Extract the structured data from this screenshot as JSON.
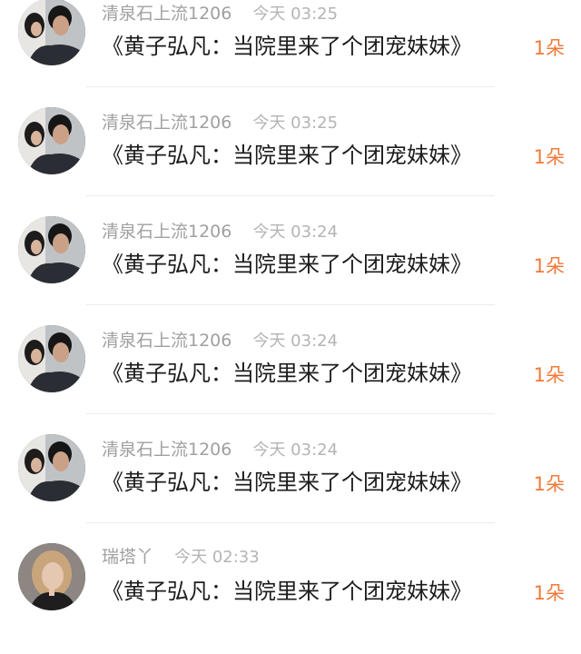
{
  "comments": [
    {
      "user": "清泉石上流1206",
      "time": "今天 03:25",
      "text": "《黄子弘凡：当院里来了个团宠妹妹》",
      "gift": "1朵",
      "avatar_icon": "couple-photo-avatar"
    },
    {
      "user": "清泉石上流1206",
      "time": "今天 03:25",
      "text": "《黄子弘凡：当院里来了个团宠妹妹》",
      "gift": "1朵",
      "avatar_icon": "couple-photo-avatar"
    },
    {
      "user": "清泉石上流1206",
      "time": "今天 03:24",
      "text": "《黄子弘凡：当院里来了个团宠妹妹》",
      "gift": "1朵",
      "avatar_icon": "couple-photo-avatar"
    },
    {
      "user": "清泉石上流1206",
      "time": "今天 03:24",
      "text": "《黄子弘凡：当院里来了个团宠妹妹》",
      "gift": "1朵",
      "avatar_icon": "couple-photo-avatar"
    },
    {
      "user": "清泉石上流1206",
      "time": "今天 03:24",
      "text": "《黄子弘凡：当院里来了个团宠妹妹》",
      "gift": "1朵",
      "avatar_icon": "couple-photo-avatar"
    },
    {
      "user": "瑞塔丫",
      "time": "今天 02:33",
      "text": "《黄子弘凡：当院里来了个团宠妹妹》",
      "gift": "1朵",
      "avatar_icon": "blonde-woman-avatar"
    }
  ],
  "colors": {
    "gift": "#f07a3a",
    "username": "#a0a0a0",
    "time": "#b4b4b4",
    "message": "#1c1c1c",
    "divider": "#ececec"
  }
}
